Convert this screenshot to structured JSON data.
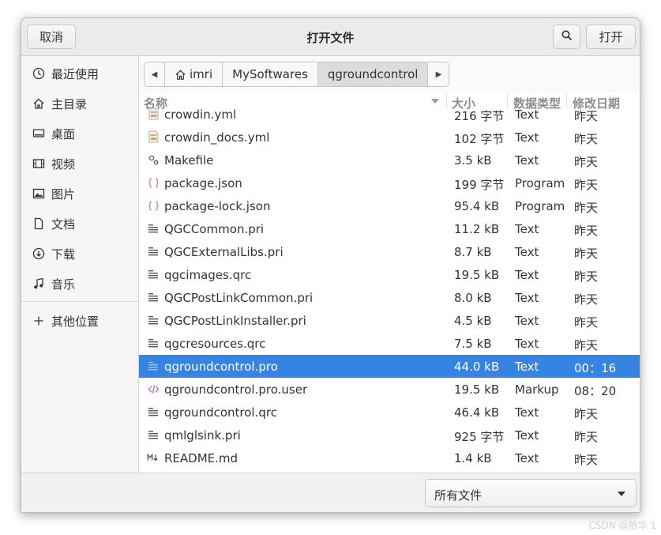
{
  "header": {
    "cancel_label": "取消",
    "title": "打开文件",
    "open_label": "打开"
  },
  "sidebar": {
    "items": [
      {
        "label": "最近使用",
        "icon": "clock-icon"
      },
      {
        "label": "主目录",
        "icon": "home-icon"
      },
      {
        "label": "桌面",
        "icon": "desktop-icon"
      },
      {
        "label": "视频",
        "icon": "video-icon"
      },
      {
        "label": "图片",
        "icon": "image-icon"
      },
      {
        "label": "文档",
        "icon": "document-icon"
      },
      {
        "label": "下载",
        "icon": "download-icon"
      },
      {
        "label": "音乐",
        "icon": "music-icon"
      },
      {
        "label": "其他位置",
        "icon": "plus-icon"
      }
    ]
  },
  "pathbar": {
    "segments": [
      "imri",
      "MySoftwares",
      "qgroundcontrol"
    ]
  },
  "columns": {
    "name": "名称",
    "size": "大小",
    "type": "数据类型",
    "modified": "修改日期"
  },
  "files": [
    {
      "name": "crowdin.yml",
      "size": "216 字节",
      "type": "Text",
      "modified": "昨天",
      "icon": "yaml-icon"
    },
    {
      "name": "crowdin_docs.yml",
      "size": "102 字节",
      "type": "Text",
      "modified": "昨天",
      "icon": "yaml-icon"
    },
    {
      "name": "Makefile",
      "size": "3.5 kB",
      "type": "Text",
      "modified": "昨天",
      "icon": "makefile-icon"
    },
    {
      "name": "package.json",
      "size": "199 字节",
      "type": "Program",
      "modified": "昨天",
      "icon": "json-icon"
    },
    {
      "name": "package-lock.json",
      "size": "95.4 kB",
      "type": "Program",
      "modified": "昨天",
      "icon": "json-icon"
    },
    {
      "name": "QGCCommon.pri",
      "size": "11.2 kB",
      "type": "Text",
      "modified": "昨天",
      "icon": "text-file-icon"
    },
    {
      "name": "QGCExternalLibs.pri",
      "size": "8.7 kB",
      "type": "Text",
      "modified": "昨天",
      "icon": "text-file-icon"
    },
    {
      "name": "qgcimages.qrc",
      "size": "19.5 kB",
      "type": "Text",
      "modified": "昨天",
      "icon": "text-file-icon"
    },
    {
      "name": "QGCPostLinkCommon.pri",
      "size": "8.0 kB",
      "type": "Text",
      "modified": "昨天",
      "icon": "text-file-icon"
    },
    {
      "name": "QGCPostLinkInstaller.pri",
      "size": "4.5 kB",
      "type": "Text",
      "modified": "昨天",
      "icon": "text-file-icon"
    },
    {
      "name": "qgcresources.qrc",
      "size": "7.5 kB",
      "type": "Text",
      "modified": "昨天",
      "icon": "text-file-icon"
    },
    {
      "name": "qgroundcontrol.pro",
      "size": "44.0 kB",
      "type": "Text",
      "modified": "00：16",
      "icon": "text-file-icon",
      "selected": true
    },
    {
      "name": "qgroundcontrol.pro.user",
      "size": "19.5 kB",
      "type": "Markup",
      "modified": "08：20",
      "icon": "markup-icon"
    },
    {
      "name": "qgroundcontrol.qrc",
      "size": "46.4 kB",
      "type": "Text",
      "modified": "昨天",
      "icon": "text-file-icon"
    },
    {
      "name": "qmlglsink.pri",
      "size": "925 字节",
      "type": "Text",
      "modified": "昨天",
      "icon": "text-file-icon"
    },
    {
      "name": "README.md",
      "size": "1.4 kB",
      "type": "Text",
      "modified": "昨天",
      "icon": "markdown-icon"
    }
  ],
  "footer": {
    "filter_label": "所有文件"
  },
  "watermark": "CSDN @拾华 1"
}
